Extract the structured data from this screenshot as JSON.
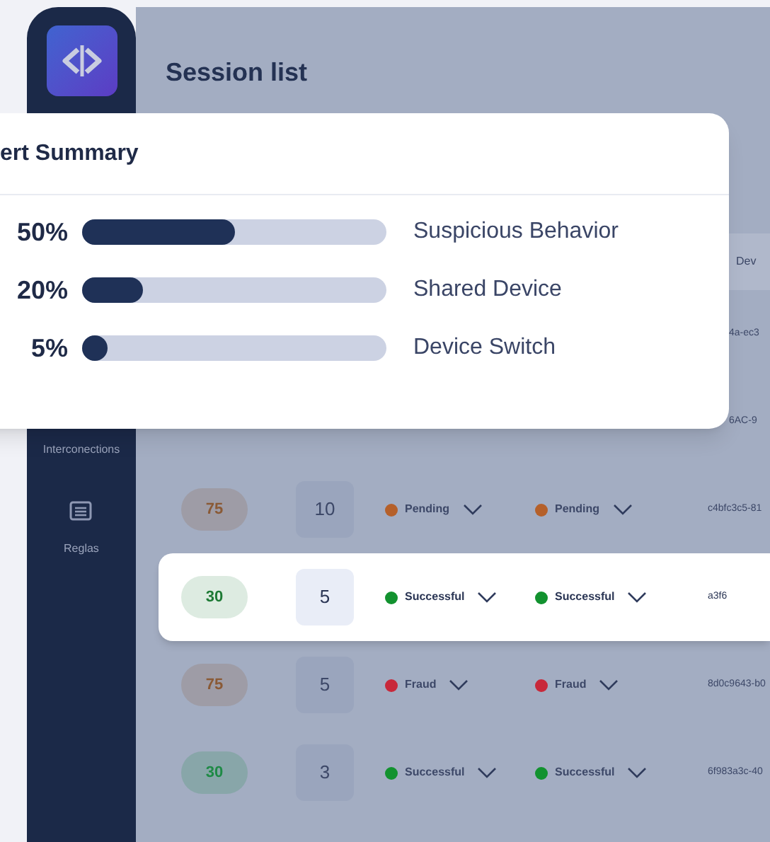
{
  "page_title": "Session list",
  "sidebar": {
    "items": [
      {
        "label": "Interconections",
        "icon": false
      },
      {
        "label": "Reglas",
        "icon": true
      }
    ]
  },
  "table": {
    "header_fragment": "Dev",
    "rows": [
      {
        "id": "4a-ec3",
        "highlighted": false
      },
      {
        "id": "6AC-9",
        "highlighted": false
      },
      {
        "score": {
          "text": "75",
          "color": "#8a5a36"
        },
        "count": "10",
        "status_1": {
          "label": "Pending",
          "color": "#b5602a"
        },
        "status_2": {
          "label": "Pending",
          "color": "#b5602a"
        },
        "id": "c4bfc3c5-81",
        "highlighted": false
      },
      {
        "score": {
          "text": "30",
          "color": "#1e7a35"
        },
        "count": "5",
        "status_1": {
          "label": "Successful",
          "color": "#12922f"
        },
        "status_2": {
          "label": "Successful",
          "color": "#12922f"
        },
        "id": "a3f6",
        "highlighted": true
      },
      {
        "score": {
          "text": "75",
          "color": "#8a5a36"
        },
        "count": "5",
        "status_1": {
          "label": "Fraud",
          "color": "#c8283a"
        },
        "status_2": {
          "label": "Fraud",
          "color": "#c8283a"
        },
        "id": "8d0c9643-b0",
        "highlighted": false
      },
      {
        "score": {
          "text": "30",
          "color": "#1e8a45"
        },
        "count": "3",
        "status_1": {
          "label": "Successful",
          "color": "#12922f"
        },
        "status_2": {
          "label": "Successful",
          "color": "#12922f"
        },
        "id": "6f983a3c-40",
        "highlighted": false
      }
    ]
  },
  "alert_summary": {
    "title": "ert Summary",
    "items": [
      {
        "percent": "50%",
        "level": 0.5,
        "label": "Suspicious Behavior"
      },
      {
        "percent": "20%",
        "level": 0.2,
        "label": "Shared Device"
      },
      {
        "percent": "5%",
        "level": 0.05,
        "label": "Device Switch"
      }
    ]
  }
}
